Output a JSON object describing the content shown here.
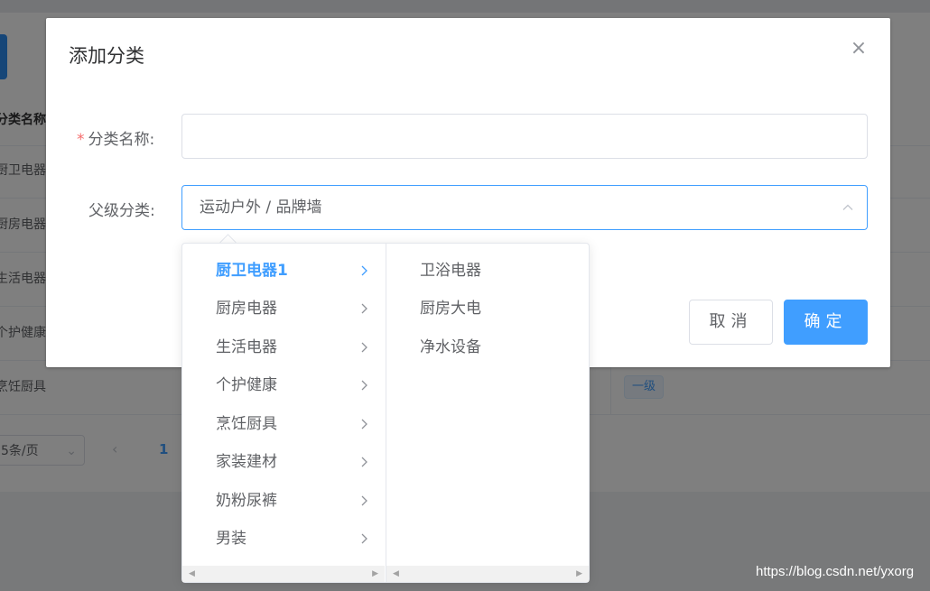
{
  "background": {
    "table": {
      "header": "分类名称",
      "rows": [
        "厨卫电器",
        "厨房电器",
        "生活电器",
        "个护健康",
        "烹饪厨具"
      ],
      "level_tag": "一级"
    },
    "pager": {
      "page_size": "5条/页",
      "prev": "‹",
      "current_page": "1"
    }
  },
  "dialog": {
    "title": "添加分类",
    "close_icon": "×",
    "fields": {
      "name_label": "分类名称:",
      "name_value": "",
      "parent_label": "父级分类:",
      "parent_value": "运动户外 / 品牌墙"
    },
    "buttons": {
      "cancel": "取消",
      "ok": "确定"
    }
  },
  "cascader": {
    "level1": [
      "厨卫电器1",
      "厨房电器",
      "生活电器",
      "个护健康",
      "烹饪厨具",
      "家装建材",
      "奶粉尿裤",
      "男装"
    ],
    "level1_active_index": 0,
    "level2": [
      "卫浴电器",
      "厨房大电",
      "净水设备"
    ]
  },
  "watermark": "https://blog.csdn.net/yxorg",
  "colors": {
    "primary": "#409eff",
    "required": "#f56c6c",
    "text": "#606266"
  }
}
